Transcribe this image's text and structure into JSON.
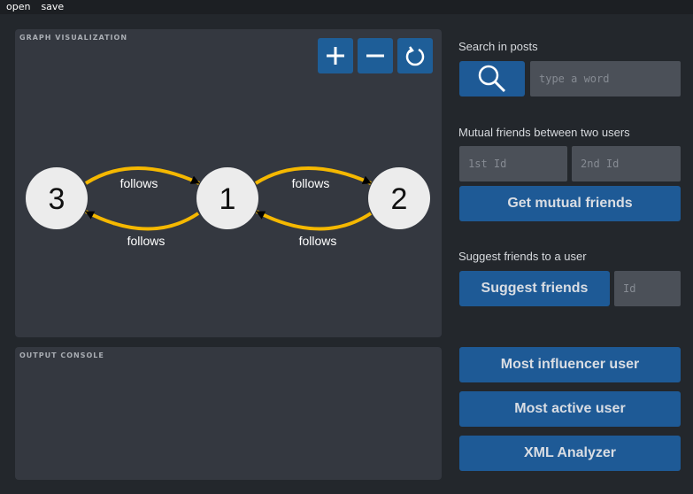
{
  "menu": {
    "open": "open",
    "save": "save"
  },
  "graph": {
    "title": "GRAPH VISUALIZATION",
    "nodes": [
      "3",
      "1",
      "2"
    ],
    "edges": [
      {
        "label": "follows"
      },
      {
        "label": "follows"
      },
      {
        "label": "follows"
      },
      {
        "label": "follows"
      }
    ],
    "controls": [
      "zoom-in",
      "zoom-out",
      "reset"
    ]
  },
  "console": {
    "title": "OUTPUT CONSOLE"
  },
  "search": {
    "label": "Search in posts",
    "placeholder": "type a word"
  },
  "mutual": {
    "label": "Mutual friends between two users",
    "first_placeholder": "1st Id",
    "second_placeholder": "2nd Id",
    "button": "Get mutual friends"
  },
  "suggest": {
    "label": "Suggest friends to a user",
    "button": "Suggest friends",
    "placeholder": "Id"
  },
  "actions": {
    "influencer": "Most influencer user",
    "active": "Most active user",
    "xml": "XML Analyzer"
  },
  "colors": {
    "accent": "#1e5a96",
    "edge": "#f5b800",
    "panel": "#343840",
    "node": "#ececec"
  }
}
